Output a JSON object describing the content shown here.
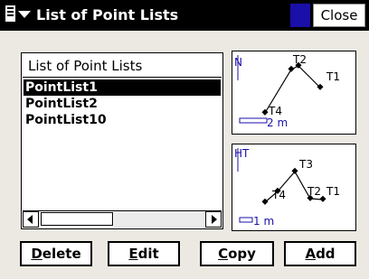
{
  "titlebar": {
    "title": "List of Point Lists",
    "close_label": "Close",
    "accent_color": "#1a0fa8"
  },
  "list": {
    "header": "List of Point Lists",
    "items": [
      "PointList1",
      "PointList2",
      "PointList10"
    ],
    "selected_index": 0
  },
  "plan_view": {
    "north_label": "N",
    "scale_label": "2 m",
    "points": [
      "T2",
      "T1",
      "T4"
    ]
  },
  "profile_view": {
    "height_label": "HT",
    "scale_label": "1 m",
    "points": [
      "T3",
      "T4",
      "T2",
      "T1"
    ]
  },
  "buttons": {
    "delete": {
      "mnemonic": "D",
      "rest": "elete"
    },
    "edit": {
      "mnemonic": "E",
      "rest": "dit"
    },
    "copy": {
      "mnemonic": "C",
      "rest": "opy"
    },
    "add": {
      "mnemonic": "A",
      "rest": "dd"
    }
  }
}
